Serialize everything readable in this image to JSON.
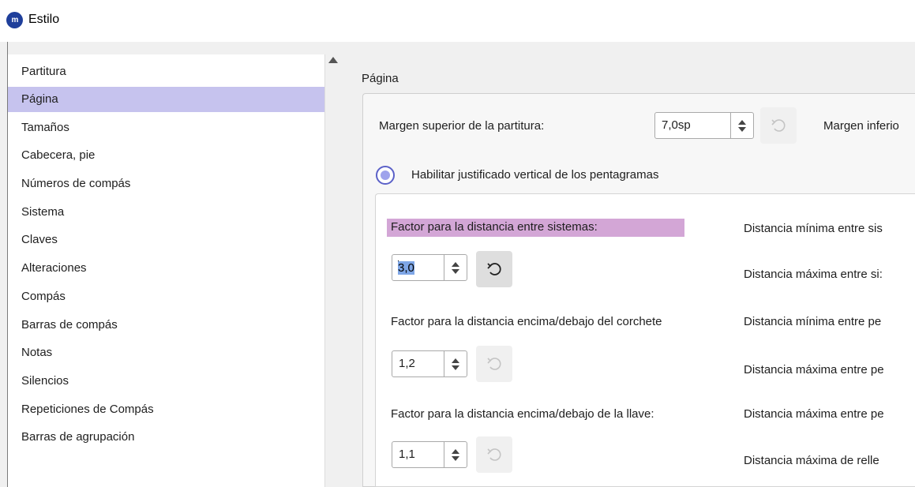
{
  "window": {
    "title": "Estilo",
    "app_icon_text": "m"
  },
  "sidebar": {
    "items": [
      {
        "label": "Partitura"
      },
      {
        "label": "Página",
        "selected": true
      },
      {
        "label": "Tamaños"
      },
      {
        "label": "Cabecera, pie"
      },
      {
        "label": "Números de compás"
      },
      {
        "label": "Sistema"
      },
      {
        "label": "Claves"
      },
      {
        "label": "Alteraciones"
      },
      {
        "label": "Compás"
      },
      {
        "label": "Barras de compás"
      },
      {
        "label": "Notas"
      },
      {
        "label": "Silencios"
      },
      {
        "label": "Repeticiones de Compás"
      },
      {
        "label": "Barras de agrupación"
      }
    ]
  },
  "page": {
    "section_title": "Página",
    "margin_top_label": "Margen superior de la partitura:",
    "margin_top_value": "7,0sp",
    "margin_bottom_label": "Margen inferio",
    "vertical_justify_label": "Habilitar justificado vertical de los pentagramas",
    "system_factor_label": "Factor para la distancia entre sistemas:",
    "system_factor_value_selected": "3,0",
    "bracket_factor_label": "Factor para la distancia encima/debajo del corchete",
    "bracket_factor_value": "1,2",
    "brace_factor_label": "Factor para la distancia encima/debajo de la llave:",
    "brace_factor_value": "1,1",
    "right_labels": [
      "Distancia mínima entre sis",
      "Distancia máxima entre si:",
      "Distancia mínima entre pe",
      "Distancia máxima entre pe",
      "Distancia máxima entre pe",
      "Distancia máxima de relle"
    ]
  },
  "colors": {
    "selection": "#c6c3ee",
    "highlight": "#d3a6d6",
    "accent": "#5b61c8"
  },
  "icons": [
    "app-logo-icon",
    "reset-icon",
    "spin-up-icon",
    "spin-down-icon",
    "scroll-up-arrow-icon"
  ]
}
